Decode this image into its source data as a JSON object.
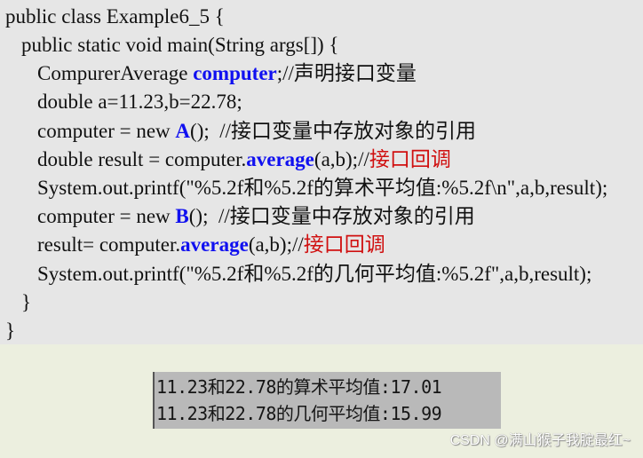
{
  "code": {
    "lines": [
      {
        "indent": 0,
        "parts": [
          {
            "text": "public class Example6_5 {",
            "style": "plain"
          }
        ]
      },
      {
        "indent": 1,
        "parts": [
          {
            "text": "public static void main(String args[]) {",
            "style": "plain"
          }
        ]
      },
      {
        "indent": 2,
        "parts": [
          {
            "text": "CompurerAverage ",
            "style": "plain"
          },
          {
            "text": "computer",
            "style": "bold-blue"
          },
          {
            "text": ";//声明接口变量",
            "style": "plain"
          }
        ]
      },
      {
        "indent": 2,
        "parts": [
          {
            "text": "double a=11.23,b=22.78;",
            "style": "plain"
          }
        ]
      },
      {
        "indent": 2,
        "parts": [
          {
            "text": "computer = new ",
            "style": "plain"
          },
          {
            "text": "A",
            "style": "bold-blue"
          },
          {
            "text": "();  //接口变量中存放对象的引用",
            "style": "plain"
          }
        ]
      },
      {
        "indent": 2,
        "parts": [
          {
            "text": "double result = computer.",
            "style": "plain"
          },
          {
            "text": "average",
            "style": "bold-blue"
          },
          {
            "text": "(a,b);//",
            "style": "plain"
          },
          {
            "text": "接口回调",
            "style": "red"
          }
        ]
      },
      {
        "indent": 2,
        "parts": [
          {
            "text": "System.out.printf(\"%5.2f和%5.2f的算术平均值:%5.2f\\n\",a,b,result);",
            "style": "plain"
          }
        ]
      },
      {
        "indent": 2,
        "parts": [
          {
            "text": "computer = new ",
            "style": "plain"
          },
          {
            "text": "B",
            "style": "bold-blue"
          },
          {
            "text": "();  //接口变量中存放对象的引用",
            "style": "plain"
          }
        ]
      },
      {
        "indent": 2,
        "parts": [
          {
            "text": "result= computer.",
            "style": "plain"
          },
          {
            "text": "average",
            "style": "bold-blue"
          },
          {
            "text": "(a,b);//",
            "style": "plain"
          },
          {
            "text": "接口回调",
            "style": "red"
          }
        ]
      },
      {
        "indent": 2,
        "parts": [
          {
            "text": "System.out.printf(\"%5.2f和%5.2f的几何平均值:%5.2f\",a,b,result);",
            "style": "plain"
          }
        ]
      },
      {
        "indent": 1,
        "parts": [
          {
            "text": "}",
            "style": "plain"
          }
        ]
      },
      {
        "indent": 0,
        "parts": [
          {
            "text": "}",
            "style": "plain"
          }
        ]
      }
    ]
  },
  "console": {
    "lines": [
      "11.23和22.78的算术平均值:17.01",
      "11.23和22.78的几何平均值:15.99"
    ]
  },
  "watermark": "CSDN @满山猴子我腚最红~",
  "colors": {
    "code_bg": "#e6e6e6",
    "page_bg": "#ecefdf",
    "keyword_blue": "#1010f0",
    "comment_red": "#d01010",
    "console_bg": "#b9b9b9"
  }
}
